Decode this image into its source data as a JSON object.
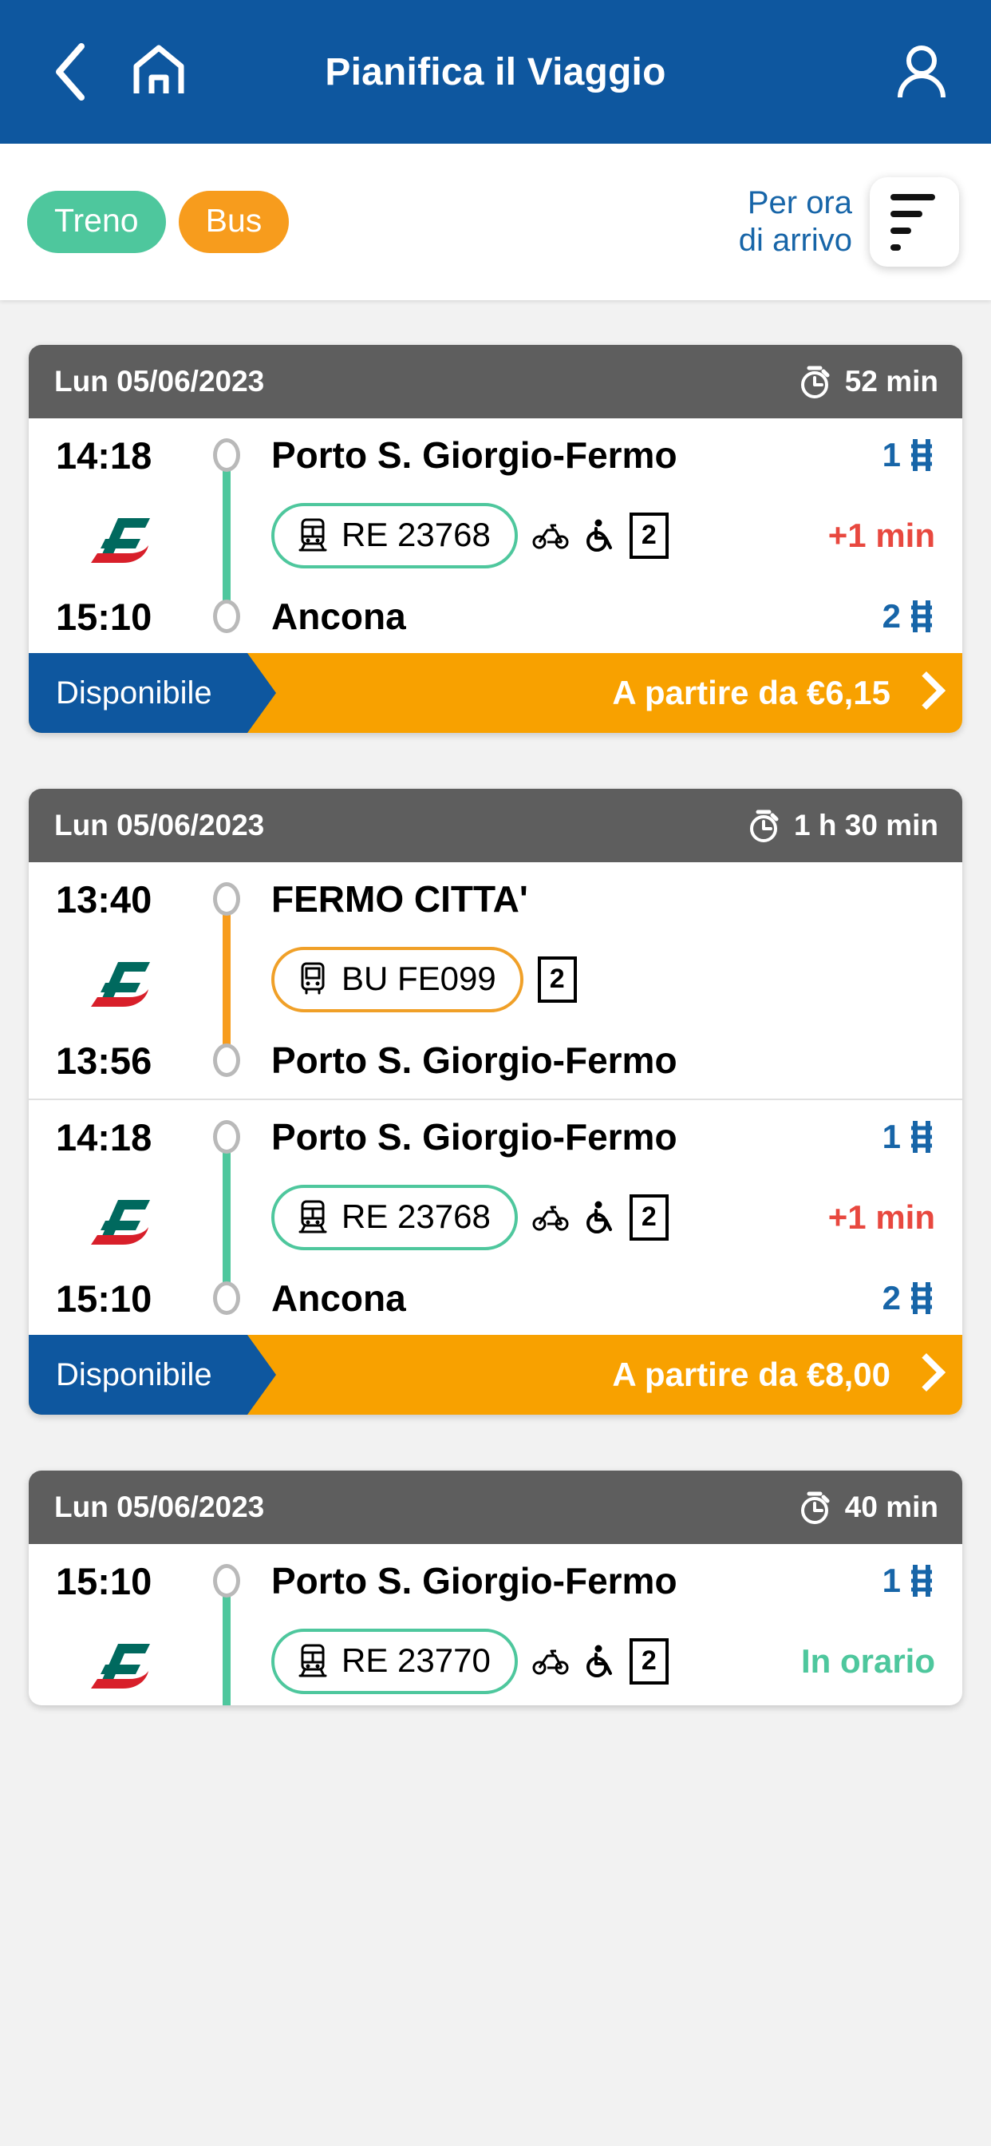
{
  "header": {
    "back_icon": "chevron-left-icon",
    "home_icon": "home-icon",
    "title": "Pianifica il Viaggio",
    "profile_icon": "person-icon"
  },
  "filters": {
    "modes": [
      {
        "label": "Treno",
        "color": "#4ec79d",
        "active": true
      },
      {
        "label": "Bus",
        "color": "#f79c1d",
        "active": true
      }
    ],
    "sort_label_line1": "Per ora",
    "sort_label_line2": "di arrivo",
    "sort_icon": "sort-lines-icon",
    "sort_label_color": "#1765a8"
  },
  "results": [
    {
      "date": "Lun 05/06/2023",
      "duration": "52 min",
      "duration_icon": "stopwatch-icon",
      "legs": [
        {
          "mode": "train",
          "line_color": "#4ec79d",
          "dep_time": "14:18",
          "dep_station": "Porto S. Giorgio-Fermo",
          "dep_platform": "1",
          "arr_time": "15:10",
          "arr_station": "Ancona",
          "arr_platform": "2",
          "operator_logo": "fs-logo",
          "service_icon": "train-icon",
          "service_code": "RE 23768",
          "amenities": [
            "bicycle-icon",
            "wheelchair-icon"
          ],
          "class_box": "2",
          "status": "+1 min",
          "status_type": "late"
        }
      ],
      "cta": {
        "availability": "Disponibile",
        "price": "A partire da €6,15",
        "arrow_icon": "chevron-right-icon"
      }
    },
    {
      "date": "Lun 05/06/2023",
      "duration": "1 h 30 min",
      "duration_icon": "stopwatch-icon",
      "legs": [
        {
          "mode": "bus",
          "line_color": "#f79c1d",
          "dep_time": "13:40",
          "dep_station": "FERMO CITTA'",
          "dep_platform": "",
          "arr_time": "13:56",
          "arr_station": "Porto S. Giorgio-Fermo",
          "arr_platform": "",
          "operator_logo": "fs-logo",
          "service_icon": "bus-icon",
          "service_code": "BU FE099",
          "amenities": [],
          "class_box": "2",
          "status": "",
          "status_type": "none"
        },
        {
          "mode": "train",
          "line_color": "#4ec79d",
          "dep_time": "14:18",
          "dep_station": "Porto S. Giorgio-Fermo",
          "dep_platform": "1",
          "arr_time": "15:10",
          "arr_station": "Ancona",
          "arr_platform": "2",
          "operator_logo": "fs-logo",
          "service_icon": "train-icon",
          "service_code": "RE 23768",
          "amenities": [
            "bicycle-icon",
            "wheelchair-icon"
          ],
          "class_box": "2",
          "status": "+1 min",
          "status_type": "late"
        }
      ],
      "cta": {
        "availability": "Disponibile",
        "price": "A partire da €8,00",
        "arrow_icon": "chevron-right-icon"
      }
    },
    {
      "date": "Lun 05/06/2023",
      "duration": "40 min",
      "duration_icon": "stopwatch-icon",
      "legs": [
        {
          "mode": "train",
          "line_color": "#4ec79d",
          "dep_time": "15:10",
          "dep_station": "Porto S. Giorgio-Fermo",
          "dep_platform": "1",
          "arr_time": "",
          "arr_station": "",
          "arr_platform": "",
          "operator_logo": "fs-logo",
          "service_icon": "train-icon",
          "service_code": "RE 23770",
          "amenities": [
            "bicycle-icon",
            "wheelchair-icon"
          ],
          "class_box": "2",
          "status": "In orario",
          "status_type": "ontime"
        }
      ],
      "cta": null
    }
  ],
  "colors": {
    "brand_blue": "#0e579f",
    "train_green": "#4ec79d",
    "bus_orange": "#f79c1d",
    "cta_orange": "#f8a100",
    "card_header_gray": "#5e5e5e",
    "late_red": "#e8483f",
    "platform_blue": "#1765a8"
  }
}
